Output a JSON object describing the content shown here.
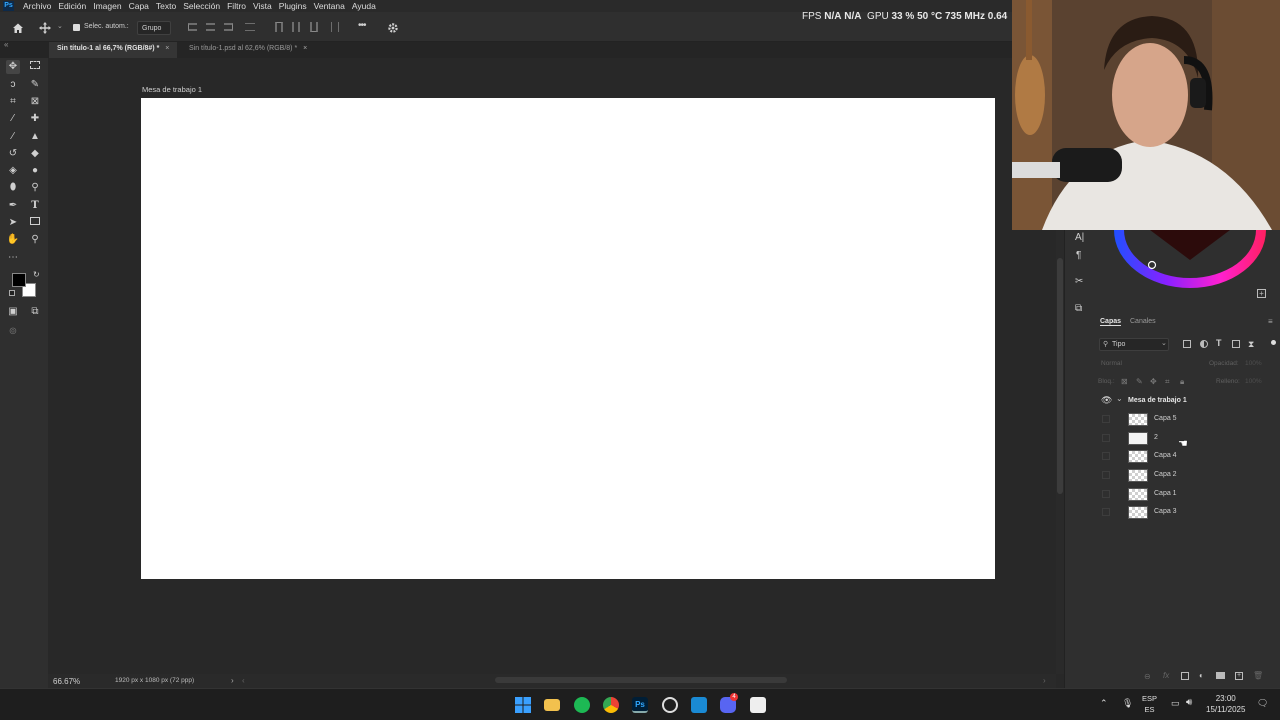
{
  "menu": {
    "app_icon": "Ps",
    "items": [
      "Archivo",
      "Edición",
      "Imagen",
      "Capa",
      "Texto",
      "Selección",
      "Filtro",
      "Vista",
      "Plugins",
      "Ventana",
      "Ayuda"
    ]
  },
  "perf": {
    "fps_label": "FPS",
    "fps_value": "N/A",
    "fps_value2": "N/A",
    "gpu_label": "GPU",
    "gpu_value": "33 % 50 °C 735 MHz 0.64"
  },
  "options_bar": {
    "auto_select_label": "Selec. autom.:",
    "auto_select_value": "Grupo",
    "more": "•••"
  },
  "tabs": [
    {
      "label": "Sin título-1 al 66,7% (RGB/8#) *",
      "active": true
    },
    {
      "label": "Sin título-1.psd al 62,6% (RGB/8) *",
      "active": false
    }
  ],
  "canvas": {
    "artboard_label": "Mesa de trabajo 1"
  },
  "status": {
    "zoom": "66.67%",
    "doc_size": "1920 px x 1080 px (72 ppp)"
  },
  "layers_panel": {
    "tabs": [
      "Capas",
      "Canales"
    ],
    "filter_label": "Tipo",
    "blend_mode": "Normal",
    "opacity_label": "Opacidad:",
    "opacity_value": "100%",
    "lock_label": "Bloq.:",
    "fill_label": "Relleno:",
    "fill_value": "100%",
    "group_name": "Mesa de trabajo 1",
    "layers": [
      {
        "name": "Capa 5"
      },
      {
        "name": "2"
      },
      {
        "name": "Capa 4"
      },
      {
        "name": "Capa 2"
      },
      {
        "name": "Capa 1"
      },
      {
        "name": "Capa 3"
      }
    ]
  },
  "taskbar": {
    "lang_top": "ESP",
    "lang_bottom": "ES",
    "time": "23:00",
    "date": "15/11/2025",
    "badge_discord": "4"
  },
  "colors": {
    "accent": "#31a8ff",
    "panel": "#2f2f2f",
    "background": "#282828"
  }
}
